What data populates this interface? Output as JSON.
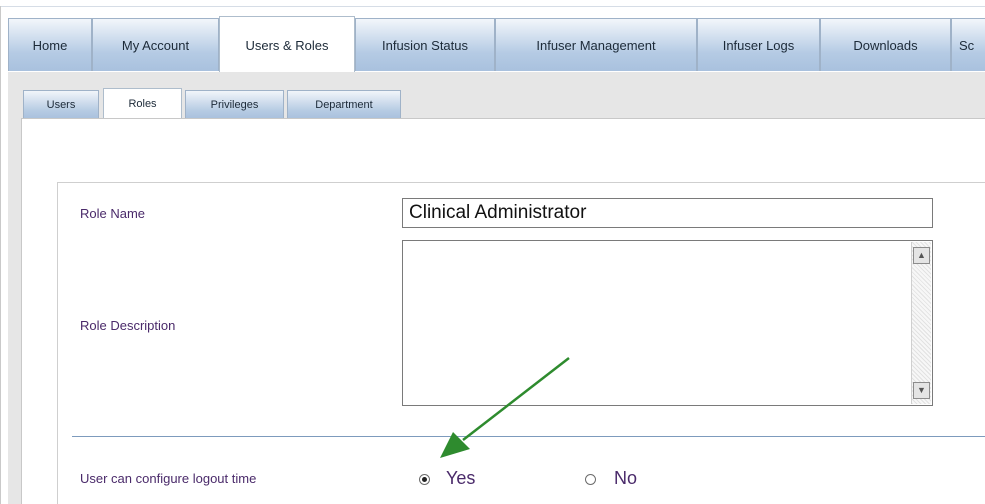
{
  "main_tabs": [
    {
      "label": "Home"
    },
    {
      "label": "My Account"
    },
    {
      "label": "Users & Roles",
      "active": true
    },
    {
      "label": "Infusion Status"
    },
    {
      "label": "Infuser Management"
    },
    {
      "label": "Infuser Logs"
    },
    {
      "label": "Downloads"
    },
    {
      "label": "Sc"
    }
  ],
  "sub_tabs": [
    {
      "label": "Users"
    },
    {
      "label": "Roles",
      "active": true
    },
    {
      "label": "Privileges"
    },
    {
      "label": "Department"
    }
  ],
  "form": {
    "role_name_label": "Role Name",
    "role_name_value": "Clinical Administrator",
    "role_description_label": "Role Description",
    "role_description_value": "",
    "logout_label": "User can configure logout time",
    "logout_options": [
      {
        "label": "Yes",
        "selected": true
      },
      {
        "label": "No",
        "selected": false
      }
    ]
  },
  "annotation": {
    "color": "#2e8b2e"
  }
}
